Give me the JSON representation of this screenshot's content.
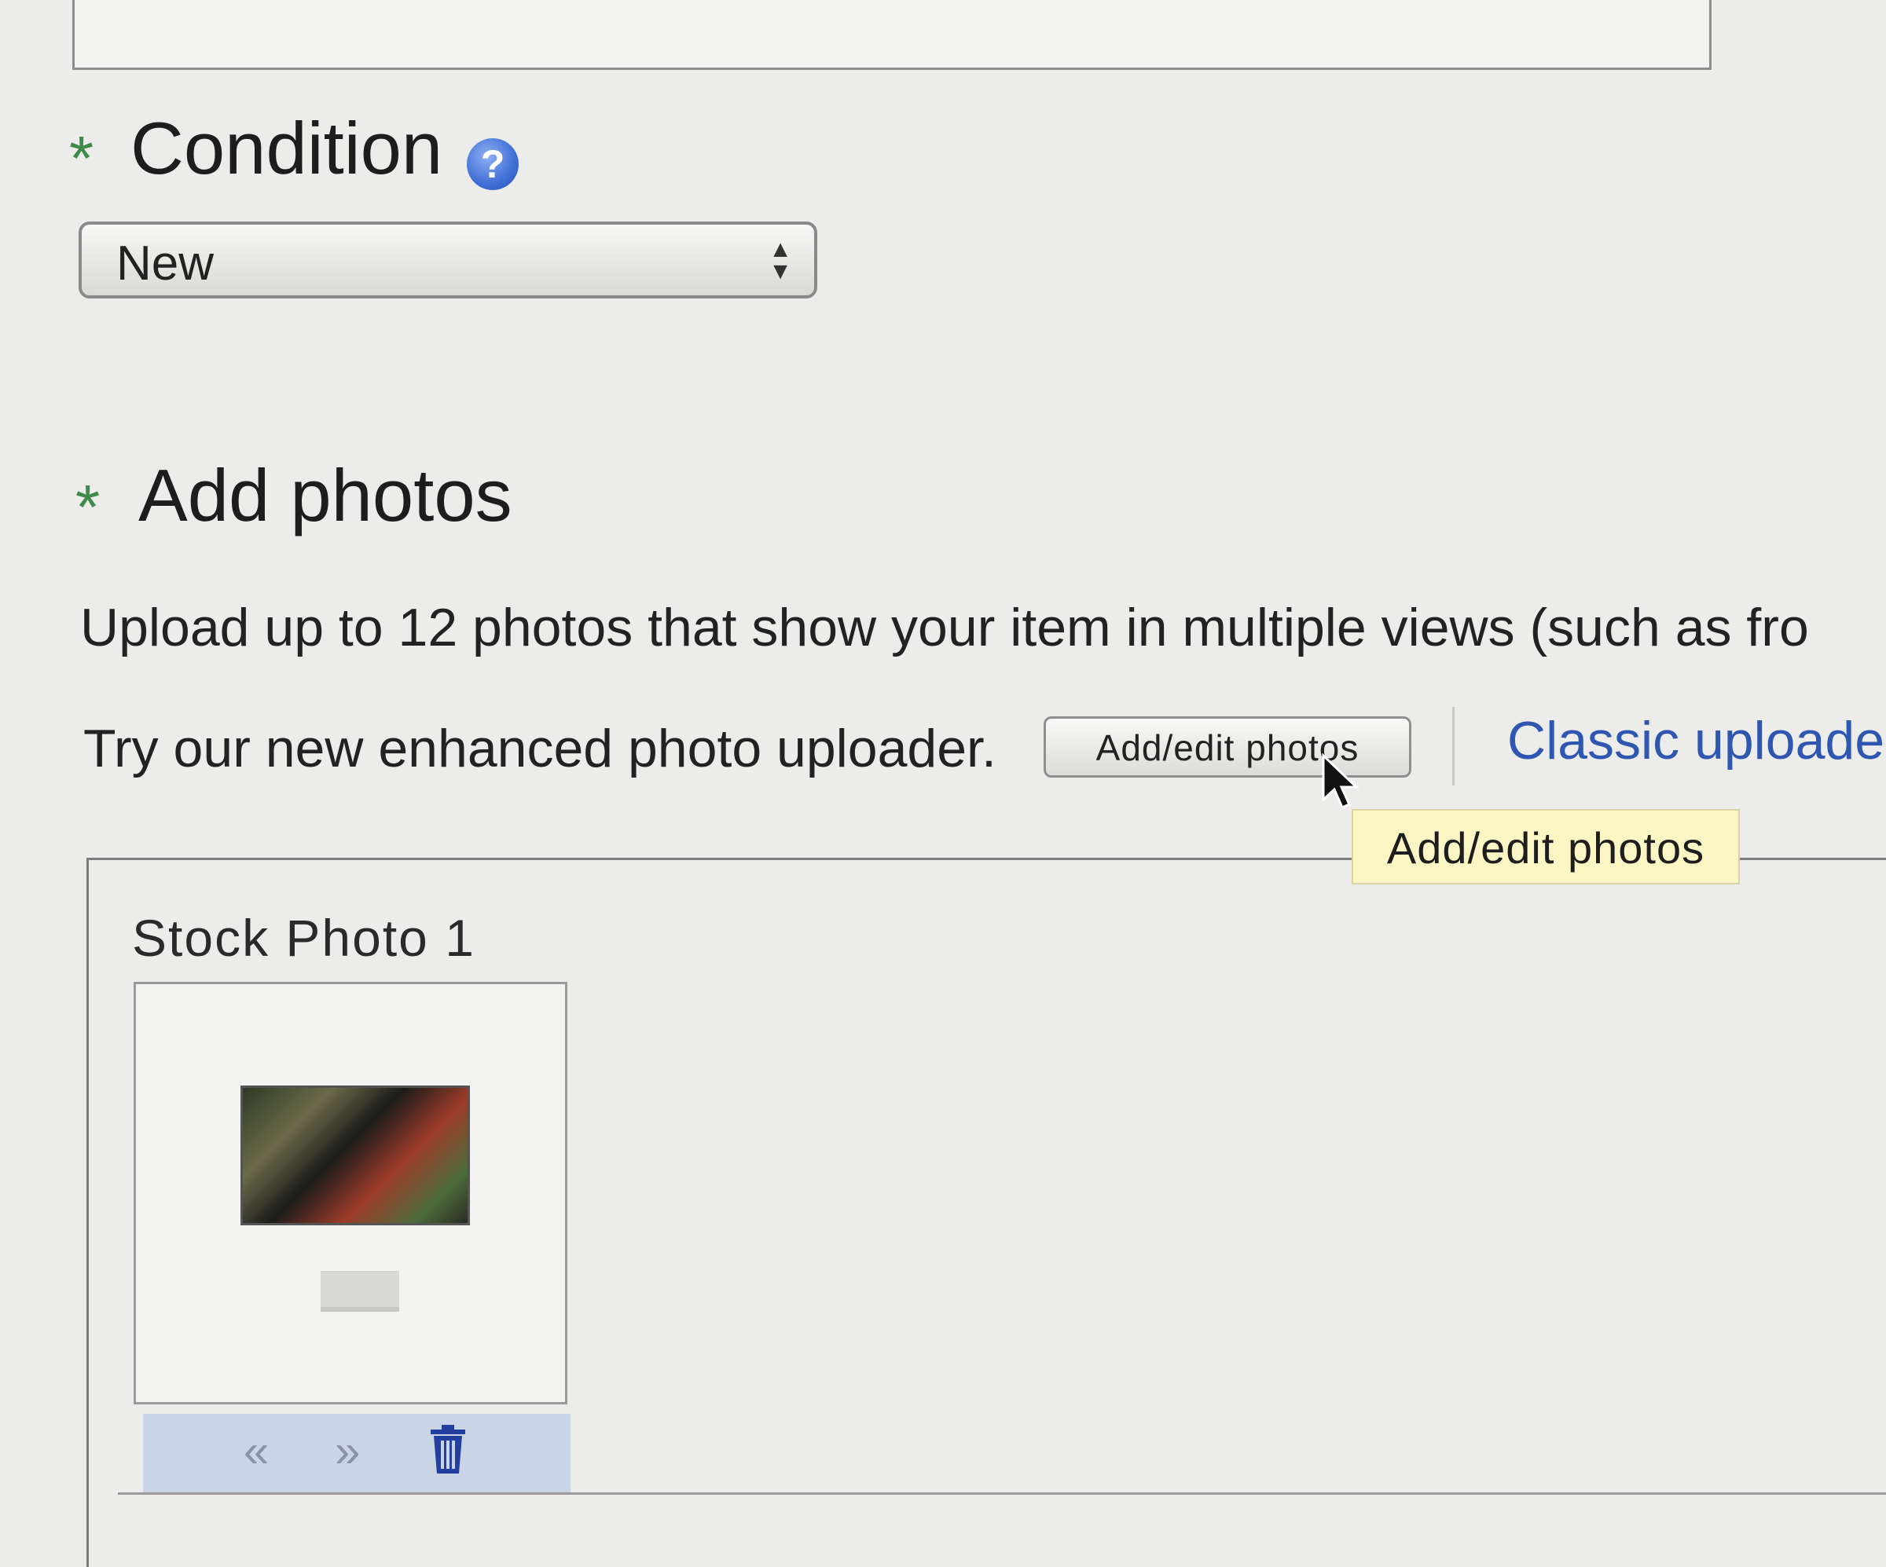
{
  "condition": {
    "required_mark": "*",
    "heading": "Condition",
    "help_icon": "?",
    "select_value": "New"
  },
  "photos": {
    "required_mark": "*",
    "heading": "Add photos",
    "intro_text": "Upload up to 12 photos that show your item in multiple views (such as fro",
    "uploader_text": "Try our new enhanced photo uploader.",
    "add_edit_button": "Add/edit photos",
    "classic_link": "Classic uploade",
    "tooltip": "Add/edit photos",
    "stock_photo_label": "Stock Photo 1",
    "toolbar": {
      "move_left_glyph": "«",
      "move_right_glyph": "»",
      "delete_icon": "trash-icon"
    }
  },
  "colors": {
    "required": "#3f8a4a",
    "link": "#2f56b0",
    "tooltip_bg": "#fbf6c4",
    "toolbar_bg": "#c9d4e6"
  }
}
